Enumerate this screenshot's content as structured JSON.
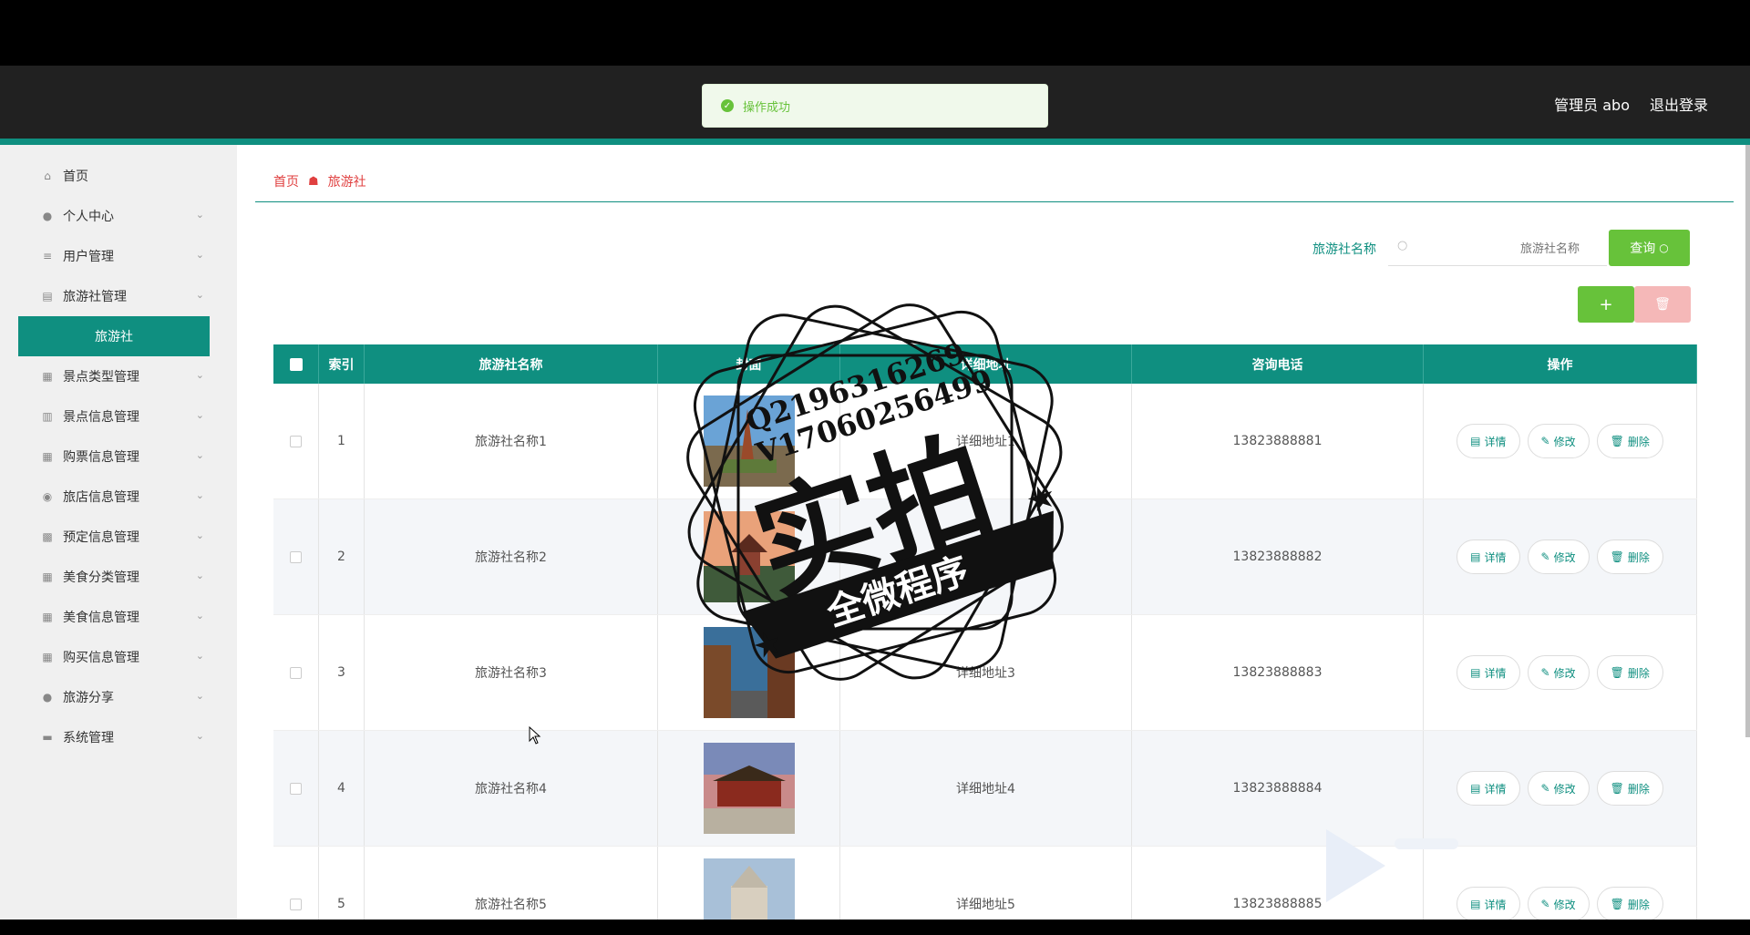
{
  "toast": {
    "message": "操作成功",
    "icon": "check-circle-icon"
  },
  "header": {
    "user": "管理员 abo",
    "logout": "退出登录"
  },
  "sidebar": {
    "items": [
      {
        "label": "首页",
        "icon": "home-icon"
      },
      {
        "label": "个人中心",
        "icon": "user-icon"
      },
      {
        "label": "用户管理",
        "icon": "list-icon"
      },
      {
        "label": "旅游社管理",
        "icon": "clipboard-icon"
      },
      {
        "label": "旅游社",
        "icon": ""
      },
      {
        "label": "景点类型管理",
        "icon": "grid-icon"
      },
      {
        "label": "景点信息管理",
        "icon": "bar-chart-icon"
      },
      {
        "label": "购票信息管理",
        "icon": "grid-icon"
      },
      {
        "label": "旅店信息管理",
        "icon": "location-icon"
      },
      {
        "label": "预定信息管理",
        "icon": "apps-icon"
      },
      {
        "label": "美食分类管理",
        "icon": "grid-icon"
      },
      {
        "label": "美食信息管理",
        "icon": "grid-icon"
      },
      {
        "label": "购买信息管理",
        "icon": "grid-icon"
      },
      {
        "label": "旅游分享",
        "icon": "user-icon"
      },
      {
        "label": "系统管理",
        "icon": "box-icon"
      }
    ]
  },
  "breadcrumb": {
    "home": "首页",
    "current": "旅游社"
  },
  "search": {
    "label": "旅游社名称",
    "placeholder": "旅游社名称",
    "button": "查询"
  },
  "table": {
    "headers": [
      "索引",
      "旅游社名称",
      "封面",
      "详细地址",
      "咨询电话",
      "操作"
    ],
    "rows": [
      {
        "index": "1",
        "name": "旅游社名称1",
        "address": "详细地址1",
        "phone": "13823888881"
      },
      {
        "index": "2",
        "name": "旅游社名称2",
        "address": "详细地址2",
        "phone": "13823888882"
      },
      {
        "index": "3",
        "name": "旅游社名称3",
        "address": "详细地址3",
        "phone": "13823888883"
      },
      {
        "index": "4",
        "name": "旅游社名称4",
        "address": "详细地址4",
        "phone": "13823888884"
      },
      {
        "index": "5",
        "name": "旅游社名称5",
        "address": "详细地址5",
        "phone": "13823888885"
      }
    ],
    "actions": {
      "detail": "详情",
      "edit": "修改",
      "delete": "删除"
    }
  },
  "stamp": {
    "line1": "Q2196316269",
    "line2": "V17060256499",
    "big": "实拍",
    "banner": "全微程序"
  },
  "colors": {
    "accent": "#0f8f80",
    "success": "#67c23a",
    "danger_light": "#f5b8b8",
    "header_bg": "#212121"
  }
}
